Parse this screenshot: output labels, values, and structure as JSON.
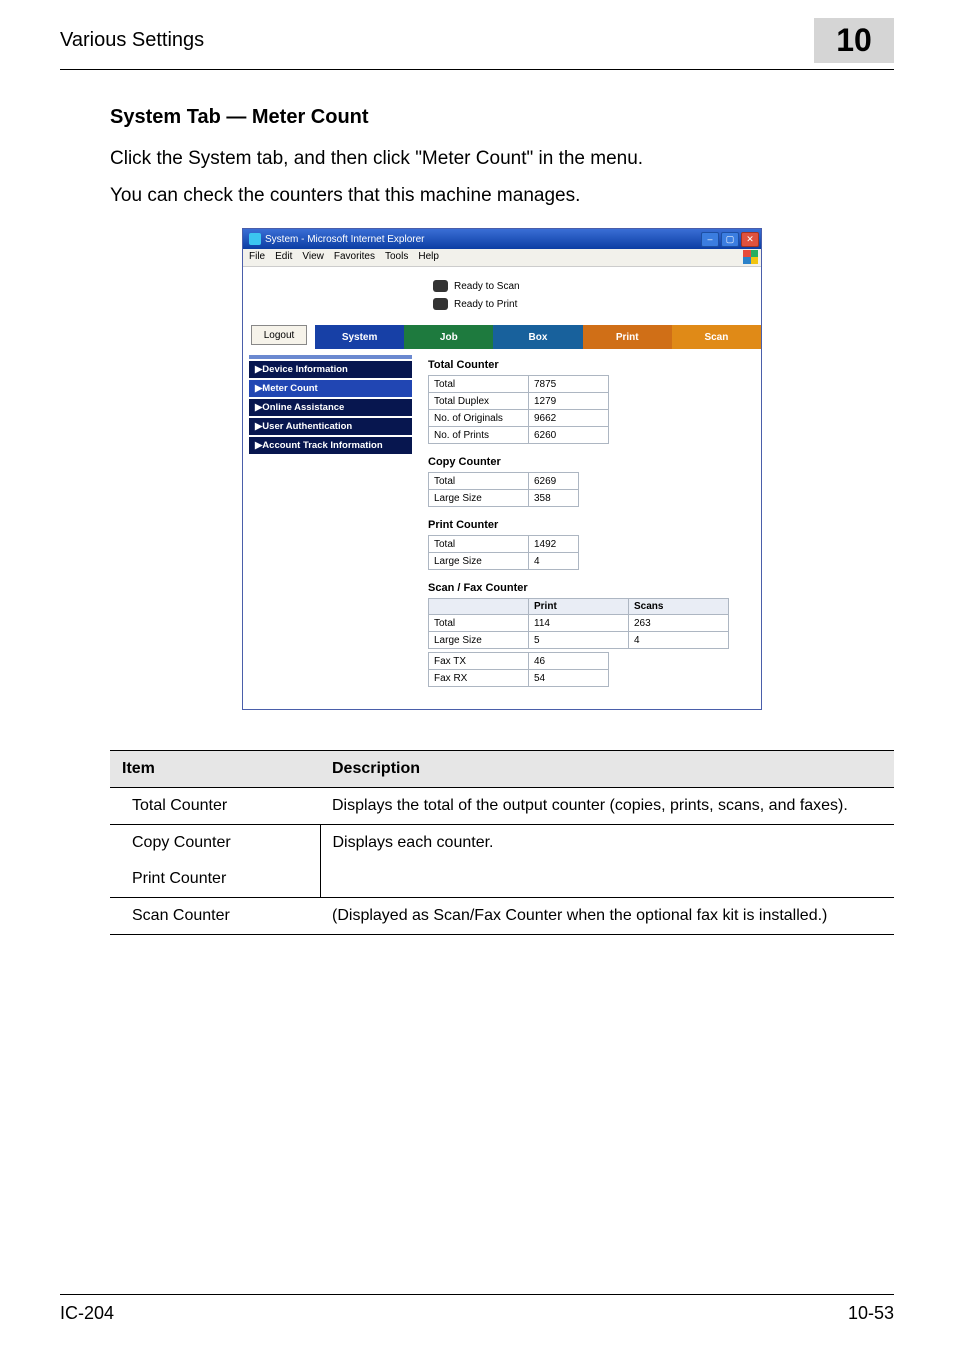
{
  "header": {
    "running_title": "Various Settings",
    "chapter_number": "10"
  },
  "section": {
    "title": "System Tab — Meter Count",
    "para1": "Click the System tab, and then click \"Meter Count\" in the menu.",
    "para2": "You can check the counters that this machine manages."
  },
  "screenshot": {
    "window_title": "System - Microsoft Internet Explorer",
    "menus": {
      "file": "File",
      "edit": "Edit",
      "view": "View",
      "favorites": "Favorites",
      "tools": "Tools",
      "help": "Help"
    },
    "banner": {
      "line1": "Ready to Scan",
      "line2": "Ready to Print"
    },
    "logout": "Logout",
    "tabs": {
      "system": "System",
      "job": "Job",
      "box": "Box",
      "print": "Print",
      "scan": "Scan"
    },
    "sidebar": {
      "device_info": "▶Device Information",
      "meter_count": "▶Meter Count",
      "online_assist": "▶Online Assistance",
      "user_auth": "▶User Authentication",
      "acct_track": "▶Account Track Information"
    },
    "blocks": {
      "total_counter": {
        "heading": "Total Counter",
        "rows": {
          "total_label": "Total",
          "total_val": "7875",
          "duplex_label": "Total Duplex",
          "duplex_val": "1279",
          "orig_label": "No. of Originals",
          "orig_val": "9662",
          "prints_label": "No. of Prints",
          "prints_val": "6260"
        }
      },
      "copy_counter": {
        "heading": "Copy Counter",
        "rows": {
          "total_label": "Total",
          "total_val": "6269",
          "large_label": "Large Size",
          "large_val": "358"
        }
      },
      "print_counter": {
        "heading": "Print Counter",
        "rows": {
          "total_label": "Total",
          "total_val": "1492",
          "large_label": "Large Size",
          "large_val": "4"
        }
      },
      "scanfax": {
        "heading": "Scan / Fax Counter",
        "cols": {
          "blank": "",
          "print": "Print",
          "scans": "Scans"
        },
        "rows": {
          "total_label": "Total",
          "total_print": "114",
          "total_scans": "263",
          "large_label": "Large Size",
          "large_print": "5",
          "large_scans": "4",
          "faxtx_label": "Fax TX",
          "faxtx_val": "46",
          "faxrx_label": "Fax RX",
          "faxrx_val": "54"
        }
      }
    }
  },
  "desc_table": {
    "head_item": "Item",
    "head_desc": "Description",
    "rows": {
      "total_item": "Total Counter",
      "total_desc": "Displays the total of the output counter (copies, prints, scans, and faxes).",
      "copy_item": "Copy Counter",
      "print_item": "Print Counter",
      "copy_print_desc": "Displays each counter.",
      "scan_item": "Scan Counter",
      "scan_desc": "(Displayed as Scan/Fax Counter when the optional fax kit is installed.)"
    }
  },
  "footer": {
    "left": "IC-204",
    "right": "10-53"
  }
}
